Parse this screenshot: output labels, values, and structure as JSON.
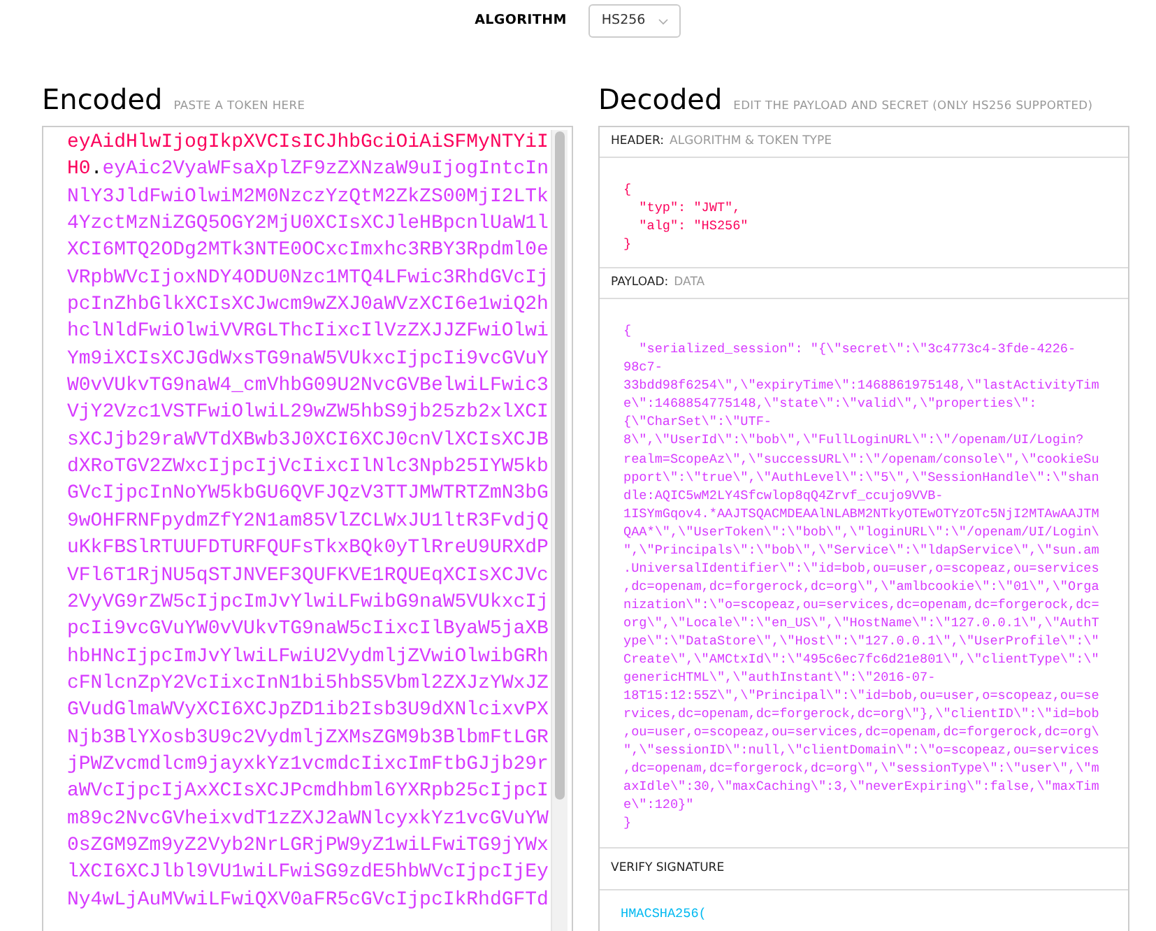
{
  "algorithm": {
    "label": "ALGORITHM",
    "value": "HS256"
  },
  "encoded": {
    "title": "Encoded",
    "hint": "PASTE A TOKEN HERE",
    "header_lines": [
      "eyAidHlwIjogIkpXVCIsICJhbGciOiAiSFMyNTYiI",
      "H0"
    ],
    "dot": ".",
    "payload_lines": [
      "eyAic2VyaWFsaXplZF9zZXNzaW9uIjogIntcIn",
      "NlY3JldFwiOlwiM2M0NzczYzQtM2ZkZS00MjI2LTk",
      "4YzctMzNiZGQ5OGY2MjU0XCIsXCJleHBpcnlUaW1l",
      "XCI6MTQ2ODg2MTk3NTE0OCxcImxhc3RBY3Rpdml0e",
      "VRpbWVcIjoxNDY4ODU0Nzc1MTQ4LFwic3RhdGVcIj",
      "pcInZhbGlkXCIsXCJwcm9wZXJ0aWVzXCI6e1wiQ2h",
      "hclNldFwiOlwiVVRGLThcIixcIlVzZXJJZFwiOlwi",
      "Ym9iXCIsXCJGdWxsTG9naW5VUkxcIjpcIi9vcGVuY",
      "W0vVUkvTG9naW4_cmVhbG09U2NvcGVBelwiLFwic3",
      "VjY2Vzc1VSTFwiOlwiL29wZW5hbS9jb25zb2xlXCI",
      "sXCJjb29raWVTdXBwb3J0XCI6XCJ0cnVlXCIsXCJB",
      "dXRoTGV2ZWxcIjpcIjVcIixcIlNlc3Npb25IYW5kb",
      "GVcIjpcInNoYW5kbGU6QVFJQzV3TTJMWTRTZmN3bG",
      "9wOHFRNFpydmZfY2N1am85VlZCLWxJU1ltR3FvdjQ",
      "uKkFBSlRTUUFDTURFQUFsTkxBQk0yTlRreU9URXdP",
      "VFl6T1RjNU5qSTJNVEF3QUFKVE1RQUEqXCIsXCJVc",
      "2VyVG9rZW5cIjpcImJvYlwiLFwibG9naW5VUkxcIj",
      "pcIi9vcGVuYW0vVUkvTG9naW5cIixcIlByaW5jaXB",
      "hbHNcIjpcImJvYlwiLFwiU2VydmljZVwiOlwibGRh",
      "cFNlcnZpY2VcIixcInN1bi5hbS5Vbml2ZXJzYWxJZ",
      "GVudGlmaWVyXCI6XCJpZD1ib2Isb3U9dXNlcixvPX",
      "Njb3BlYXosb3U9c2VydmljZXMsZGM9b3BlbmFtLGR",
      "jPWZvcmdlcm9jayxkYz1vcmdcIixcImFtbGJjb29r",
      "aWVcIjpcIjAxXCIsXCJPcmdhbml6YXRpb25cIjpcI",
      "m89c2NvcGVheixvdT1zZXJ2aWNlcyxkYz1vcGVuYW",
      "0sZGM9Zm9yZ2Vyb2NrLGRjPW9yZ1wiLFwiTG9jYWx",
      "lXCI6XCJlbl9VU1wiLFwiSG9zdE5hbWVcIjpcIjEy",
      "Ny4wLjAuMVwiLFwiQXV0aFR5cGVcIjpcIkRhdGFTd"
    ]
  },
  "decoded": {
    "title": "Decoded",
    "hint": "EDIT THE PAYLOAD AND SECRET (ONLY HS256 SUPPORTED)",
    "sections": [
      {
        "kind": "header",
        "label": "HEADER:",
        "sublabel": "ALGORITHM & TOKEN TYPE",
        "open": "{",
        "lines": [
          "\"typ\": \"JWT\",",
          "\"alg\": \"HS256\""
        ],
        "close": "}"
      },
      {
        "kind": "payload",
        "label": "PAYLOAD:",
        "sublabel": "DATA",
        "open": "{",
        "lines": [
          "\"serialized_session\": \"{\\\"secret\\\":\\\"3c4773c4-3fde-4226-",
          "98c7-",
          "33bdd98f6254\\\",\\\"expiryTime\\\":1468861975148,\\\"lastActivityTim",
          "e\\\":1468854775148,\\\"state\\\":\\\"valid\\\",\\\"properties\\\":",
          "{\\\"CharSet\\\":\\\"UTF-",
          "8\\\",\\\"UserId\\\":\\\"bob\\\",\\\"FullLoginURL\\\":\\\"/openam/UI/Login?",
          "realm=ScopeAz\\\",\\\"successURL\\\":\\\"/openam/console\\\",\\\"cookieSu",
          "pport\\\":\\\"true\\\",\\\"AuthLevel\\\":\\\"5\\\",\\\"SessionHandle\\\":\\\"shan",
          "dle:AQIC5wM2LY4Sfcwlop8qQ4Zrvf_ccujo9VVB-",
          "1ISYmGqov4.*AAJTSQACMDEAAlNLABM2NTkyOTEwOTYzOTc5NjI2MTAwAAJTM",
          "QAA*\\\",\\\"UserToken\\\":\\\"bob\\\",\\\"loginURL\\\":\\\"/openam/UI/Login\\",
          "\",\\\"Principals\\\":\\\"bob\\\",\\\"Service\\\":\\\"ldapService\\\",\\\"sun.am",
          ".UniversalIdentifier\\\":\\\"id=bob,ou=user,o=scopeaz,ou=services",
          ",dc=openam,dc=forgerock,dc=org\\\",\\\"amlbcookie\\\":\\\"01\\\",\\\"Orga",
          "nization\\\":\\\"o=scopeaz,ou=services,dc=openam,dc=forgerock,dc=",
          "org\\\",\\\"Locale\\\":\\\"en_US\\\",\\\"HostName\\\":\\\"127.0.0.1\\\",\\\"AuthT",
          "ype\\\":\\\"DataStore\\\",\\\"Host\\\":\\\"127.0.0.1\\\",\\\"UserProfile\\\":\\\"",
          "Create\\\",\\\"AMCtxId\\\":\\\"495c6ec7fc6d21e801\\\",\\\"clientType\\\":\\\"",
          "genericHTML\\\",\\\"authInstant\\\":\\\"2016-07-",
          "18T15:12:55Z\\\",\\\"Principal\\\":\\\"id=bob,ou=user,o=scopeaz,ou=se",
          "rvices,dc=openam,dc=forgerock,dc=org\\\"},\\\"clientID\\\":\\\"id=bob",
          ",ou=user,o=scopeaz,ou=services,dc=openam,dc=forgerock,dc=org\\",
          "\",\\\"sessionID\\\":null,\\\"clientDomain\\\":\\\"o=scopeaz,ou=services",
          ",dc=openam,dc=forgerock,dc=org\\\",\\\"sessionType\\\":\\\"user\\\",\\\"m",
          "axIdle\\\":30,\\\"maxCaching\\\":3,\\\"neverExpiring\\\":false,\\\"maxTim",
          "e\\\":120}\""
        ],
        "close": "}"
      },
      {
        "kind": "signature",
        "label": "VERIFY SIGNATURE",
        "lines": [
          "HMACSHA256("
        ]
      }
    ]
  }
}
